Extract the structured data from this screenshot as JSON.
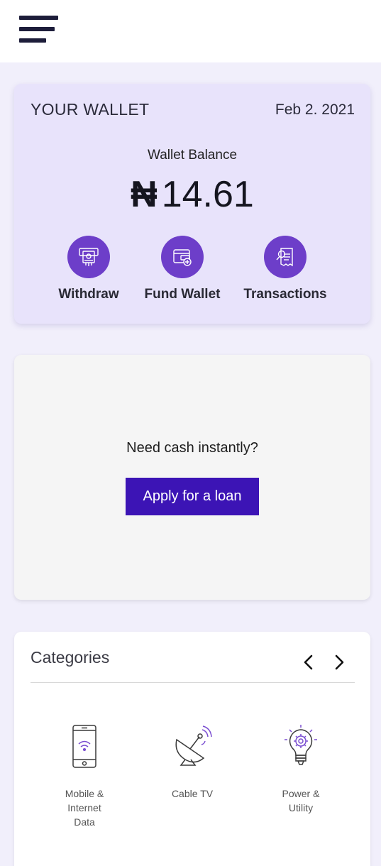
{
  "header": {
    "menu_icon": "hamburger-menu-icon"
  },
  "wallet": {
    "title": "YOUR WALLET",
    "date": "Feb 2. 2021",
    "balance_label": "Wallet Balance",
    "currency_symbol": "₦",
    "balance_value": "14.61",
    "actions": [
      {
        "label": "Withdraw",
        "icon": "atm-withdraw-icon"
      },
      {
        "label": "Fund Wallet",
        "icon": "wallet-add-icon"
      },
      {
        "label": "Transactions",
        "icon": "receipt-search-icon"
      }
    ],
    "accent_color": "#6d3ec9"
  },
  "loan": {
    "question": "Need cash instantly?",
    "button_label": "Apply for a loan",
    "button_color": "#3c14b5"
  },
  "categories": {
    "title": "Categories",
    "prev_icon": "chevron-left-icon",
    "next_icon": "chevron-right-icon",
    "items": [
      {
        "label_lines": [
          "Mobile &",
          "Internet",
          "Data"
        ],
        "icon": "mobile-wifi-icon"
      },
      {
        "label_lines": [
          "Cable TV"
        ],
        "icon": "satellite-dish-icon"
      },
      {
        "label_lines": [
          "Power &",
          "Utility"
        ],
        "icon": "lightbulb-gear-icon"
      }
    ]
  }
}
